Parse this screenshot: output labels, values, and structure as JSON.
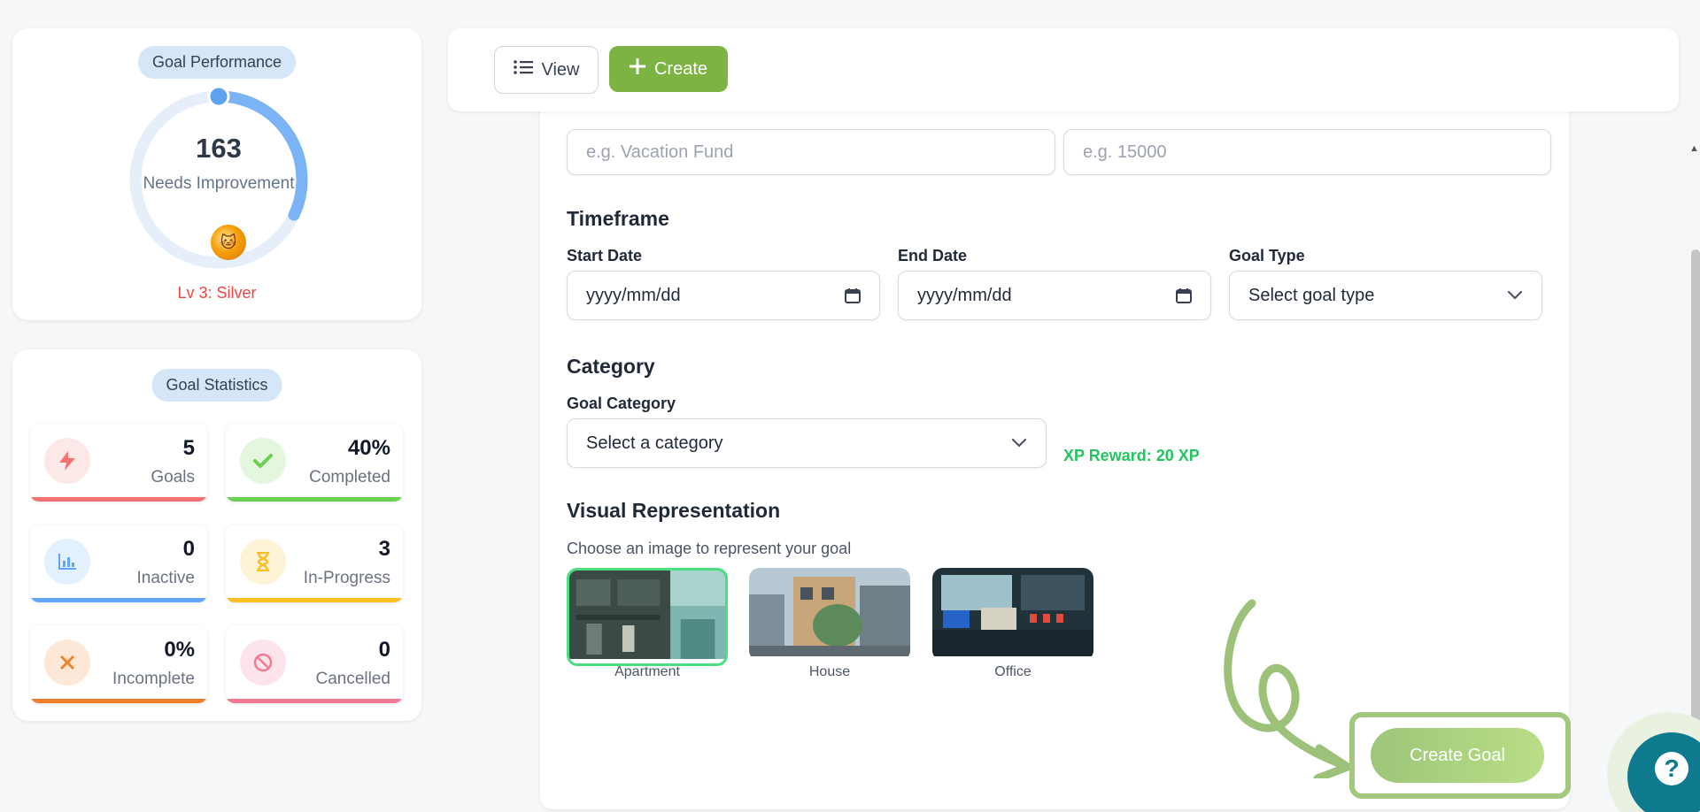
{
  "performance": {
    "title": "Goal Performance",
    "score": "163",
    "status": "Needs Improvement",
    "level": "Lv 3: Silver",
    "progress_fraction": 0.32
  },
  "statistics": {
    "title": "Goal Statistics",
    "cards": [
      {
        "value": "5",
        "label": "Goals",
        "icon": "bolt-icon",
        "color": "#f87171"
      },
      {
        "value": "40%",
        "label": "Completed",
        "icon": "check-icon",
        "color": "#6ad04f"
      },
      {
        "value": "0",
        "label": "Inactive",
        "icon": "bar-chart-icon",
        "color": "#60a5fa"
      },
      {
        "value": "3",
        "label": "In-Progress",
        "icon": "hourglass-icon",
        "color": "#fbbf24"
      },
      {
        "value": "0%",
        "label": "Incomplete",
        "icon": "x-icon",
        "color": "#f07f2c"
      },
      {
        "value": "0",
        "label": "Cancelled",
        "icon": "ban-icon",
        "color": "#f47a93"
      }
    ]
  },
  "toolbar": {
    "view_label": "View",
    "create_label": "Create"
  },
  "form": {
    "name_placeholder": "e.g. Vacation Fund",
    "amount_placeholder": "e.g. 15000",
    "timeframe": {
      "title": "Timeframe",
      "start_label": "Start Date",
      "start_value": "yyyy/mm/dd",
      "end_label": "End Date",
      "end_value": "yyyy/mm/dd",
      "type_label": "Goal Type",
      "type_value": "Select goal type"
    },
    "category": {
      "title": "Category",
      "label": "Goal Category",
      "value": "Select a category",
      "xp_reward": "XP Reward: 20 XP"
    },
    "visual": {
      "title": "Visual Representation",
      "helper": "Choose an image to represent your goal",
      "options": [
        "Apartment",
        "House",
        "Office"
      ],
      "selected": "Apartment"
    },
    "submit_label": "Create Goal"
  },
  "help": {
    "icon": "question-icon"
  },
  "colors": {
    "accent_green": "#7cb342",
    "gauge_blue": "#7ab4f5",
    "gauge_track": "#e6eef9",
    "help_teal": "#0e7a8e",
    "xp_green": "#22c55e",
    "level_red": "#ef4444"
  }
}
